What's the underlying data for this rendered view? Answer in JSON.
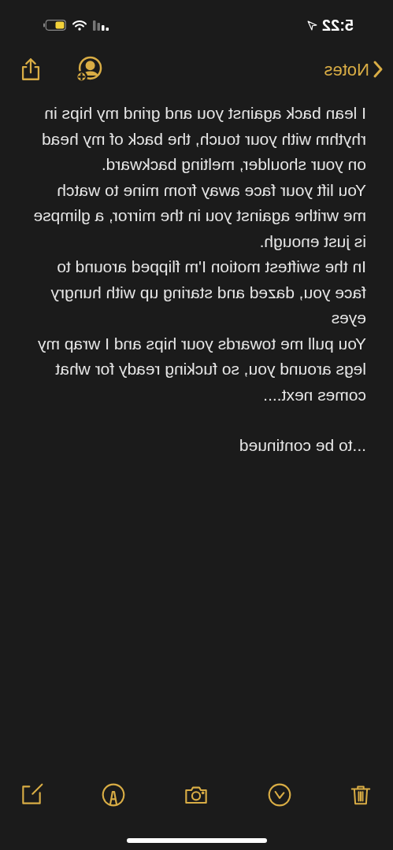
{
  "status_bar": {
    "time": "5:22"
  },
  "nav": {
    "back_label": "Notes"
  },
  "note": {
    "paragraphs": [
      "I lean back against you and grind my hips in rhythm with your touch, the back of my head on your shoulder, melting backward.",
      "You lift your face away from mine to watch me writhe against you in the mirror, a glimpse is just enough.",
      "In the swiftest motion I'm flipped around to face you, dazed and staring up with hungry eyes",
      "You pull me towards your hips and I wrap my legs around you, so fucking ready for what comes next....",
      "...to be continued"
    ]
  }
}
